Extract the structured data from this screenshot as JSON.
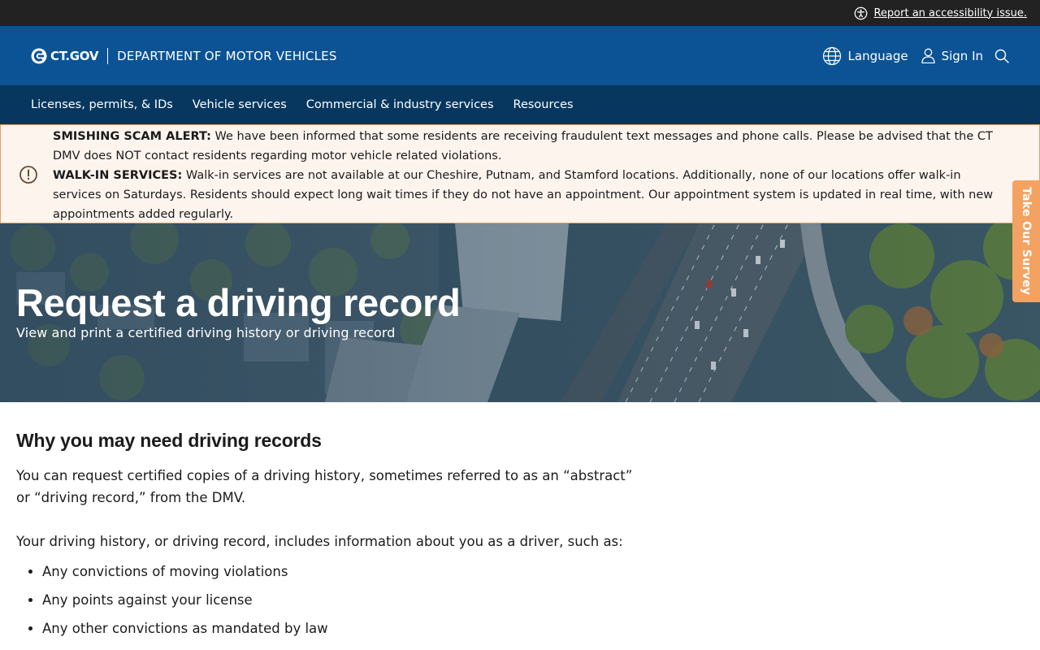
{
  "utility": {
    "accessibility_link": "Report an accessibility issue."
  },
  "header": {
    "logo_text": "CT.GOV",
    "agency": "DEPARTMENT OF MOTOR VEHICLES",
    "language_label": "Language",
    "signin_label": "Sign In"
  },
  "nav": {
    "items": [
      {
        "label": "Licenses, permits, & IDs"
      },
      {
        "label": "Vehicle services"
      },
      {
        "label": "Commercial & industry services"
      },
      {
        "label": "Resources"
      }
    ]
  },
  "alert": {
    "scam_heading": "SMISHING SCAM ALERT:",
    "scam_text": " We have been informed that some residents are receiving fraudulent text messages and phone calls. Please be advised that the CT DMV does NOT contact residents regarding motor vehicle related violations.",
    "walkin_heading": "WALK-IN SERVICES:",
    "walkin_text": " Walk-in services are not available at our Cheshire, Putnam, and Stamford locations. Additionally, none of our locations offer walk-in services on Saturdays. Residents should expect long wait times if they do not have an appointment. Our appointment system is updated in real time, with new appointments added regularly."
  },
  "hero": {
    "title": "Request a driving record",
    "subtitle": "View and print a certified driving history or driving record"
  },
  "survey": {
    "label": "Take Our Survey"
  },
  "content": {
    "section_title": "Why you may need driving records",
    "paragraph1": "You can request certified copies of a driving history, sometimes referred to as an “abstract” or “driving record,” from the DMV.",
    "paragraph2": "Your driving history, or driving record, includes information about you as a driver, such as:",
    "bullets": [
      "Any convictions of moving violations",
      "Any points against your license",
      "Any other convictions as mandated by law"
    ]
  },
  "colors": {
    "utility_bar": "#222222",
    "header": "#0b5394",
    "nav": "#07375f",
    "alert_bg": "#fdf4ee",
    "alert_border": "#e0a15f",
    "survey_tab": "#f4a261"
  }
}
